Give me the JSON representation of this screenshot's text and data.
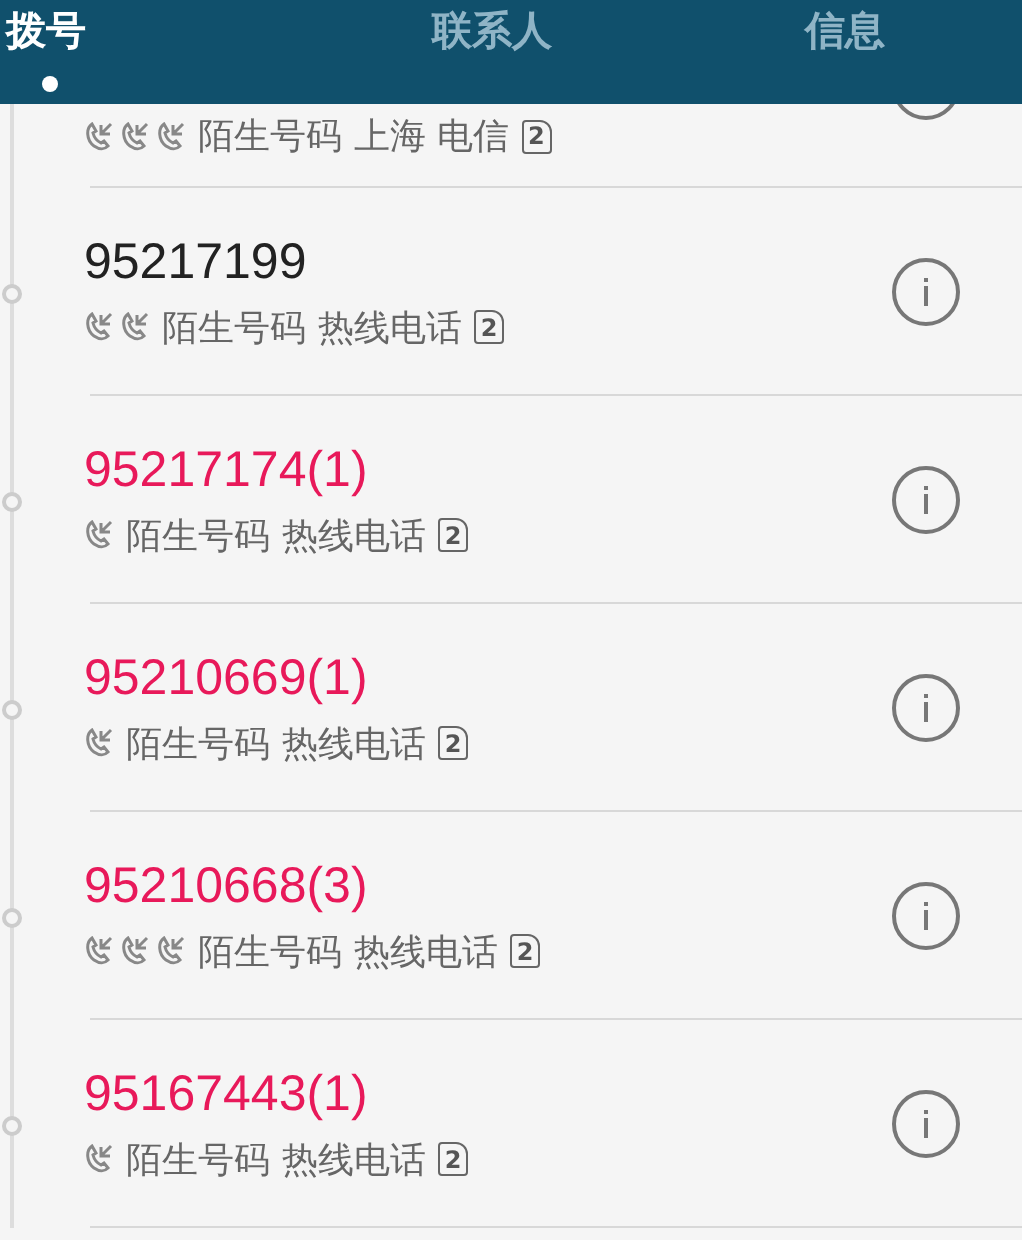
{
  "tabs": [
    {
      "label": "拨号",
      "selected": true
    },
    {
      "label": "联系人",
      "selected": false
    },
    {
      "label": "信息",
      "selected": false
    }
  ],
  "calls": [
    {
      "call_types": [
        {
          "kind": "incoming"
        },
        {
          "kind": "incoming"
        },
        {
          "kind": "incoming"
        }
      ],
      "label": "陌生号码",
      "location": "上海 电信",
      "sim": "2"
    },
    {
      "number": "95217199",
      "missed": false,
      "call_types": [
        {
          "kind": "incoming"
        },
        {
          "kind": "incoming"
        }
      ],
      "label": "陌生号码",
      "location": "热线电话",
      "sim": "2"
    },
    {
      "number": "95217174(1)",
      "missed": true,
      "call_types": [
        {
          "kind": "incoming"
        }
      ],
      "label": "陌生号码",
      "location": "热线电话",
      "sim": "2"
    },
    {
      "number": "95210669(1)",
      "missed": true,
      "call_types": [
        {
          "kind": "incoming"
        }
      ],
      "label": "陌生号码",
      "location": "热线电话",
      "sim": "2"
    },
    {
      "number": "95210668(3)",
      "missed": true,
      "call_types": [
        {
          "kind": "incoming"
        },
        {
          "kind": "incoming"
        },
        {
          "kind": "incoming"
        }
      ],
      "label": "陌生号码",
      "location": "热线电话",
      "sim": "2"
    },
    {
      "number": "95167443(1)",
      "missed": true,
      "call_types": [
        {
          "kind": "incoming"
        }
      ],
      "label": "陌生号码",
      "location": "热线电话",
      "sim": "2"
    }
  ]
}
